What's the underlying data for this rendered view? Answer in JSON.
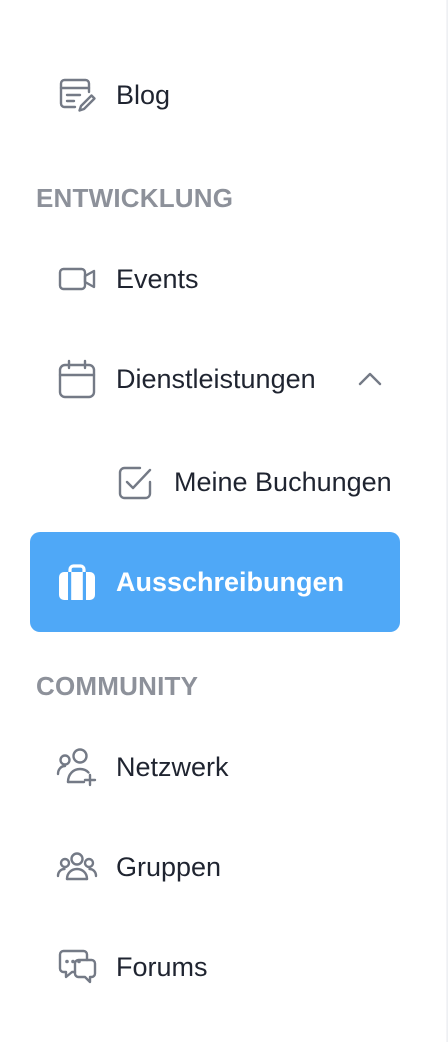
{
  "sidebar": {
    "items": {
      "blog": {
        "label": "Blog",
        "icon": "blog-edit-icon"
      },
      "events": {
        "label": "Events",
        "icon": "video-camera-icon"
      },
      "services": {
        "label": "Dienstleistungen",
        "icon": "calendar-icon",
        "expanded": true
      },
      "my_bookings": {
        "label": "Meine Buchungen",
        "icon": "check-square-icon"
      },
      "tenders": {
        "label": "Ausschreibungen",
        "icon": "briefcase-icon",
        "active": true
      },
      "network": {
        "label": "Netzwerk",
        "icon": "user-plus-icon"
      },
      "groups": {
        "label": "Gruppen",
        "icon": "users-group-icon"
      },
      "forums": {
        "label": "Forums",
        "icon": "chat-bubbles-icon"
      }
    },
    "sections": {
      "development": "ENTWICKLUNG",
      "community": "COMMUNITY"
    }
  },
  "colors": {
    "active_background": "#4fa8f7",
    "active_text": "#ffffff",
    "text": "#1f2430",
    "icon": "#747a86",
    "section_heading": "#8d919a"
  }
}
